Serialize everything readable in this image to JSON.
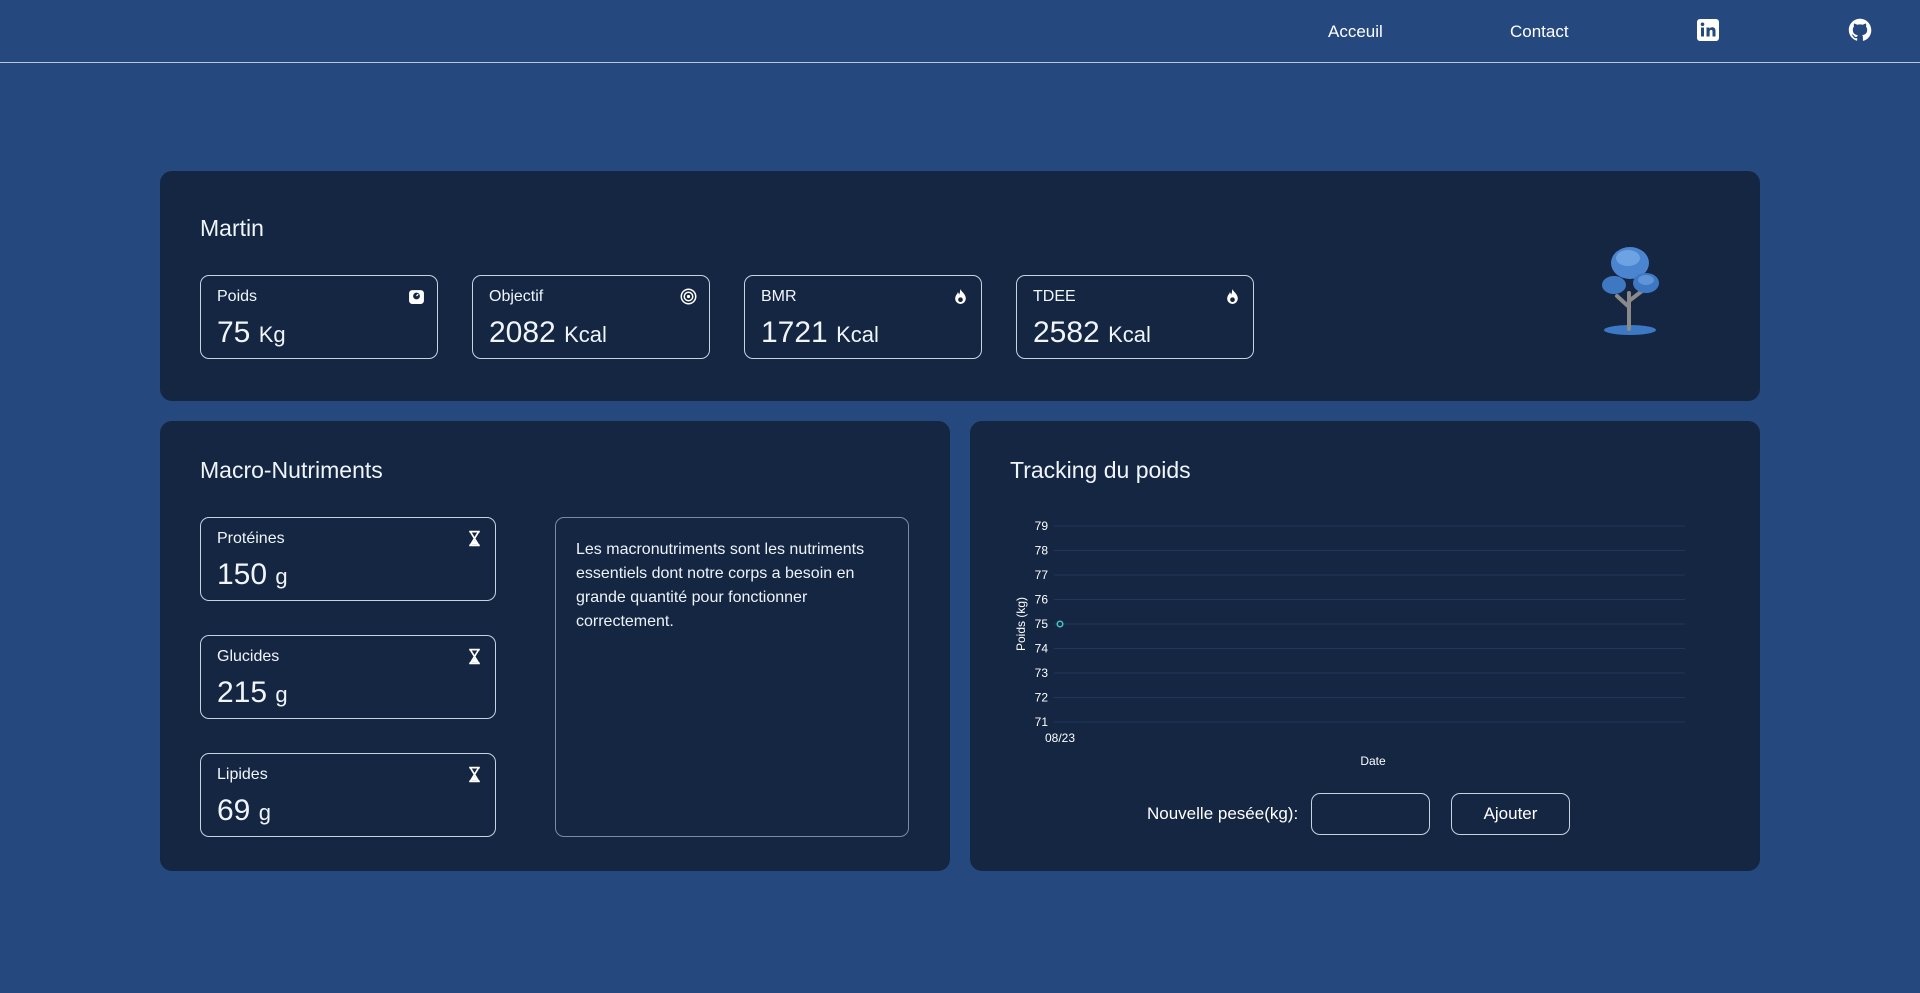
{
  "nav": {
    "links": [
      "Acceuil",
      "Contact"
    ],
    "icons": [
      "linkedin-icon",
      "github-icon"
    ]
  },
  "profile": {
    "name": "Martin",
    "stats": [
      {
        "label": "Poids",
        "value": "75",
        "unit": "Kg",
        "icon": "scale-icon"
      },
      {
        "label": "Objectif",
        "value": "2082",
        "unit": "Kcal",
        "icon": "target-icon"
      },
      {
        "label": "BMR",
        "value": "1721",
        "unit": "Kcal",
        "icon": "flame-icon"
      },
      {
        "label": "TDEE",
        "value": "2582",
        "unit": "Kcal",
        "icon": "flame-icon"
      }
    ],
    "illustration": "tree-illustration"
  },
  "macros": {
    "title": "Macro-Nutriments",
    "items": [
      {
        "label": "Protéines",
        "value": "150",
        "unit": "g",
        "icon": "hourglass-icon"
      },
      {
        "label": "Glucides",
        "value": "215",
        "unit": "g",
        "icon": "hourglass-icon"
      },
      {
        "label": "Lipides",
        "value": "69",
        "unit": "g",
        "icon": "hourglass-icon"
      }
    ],
    "description": "Les macronutriments sont les nutriments essentiels dont notre corps a besoin en grande quantité pour fonctionner correctement."
  },
  "tracking": {
    "title": "Tracking du poids",
    "input_label": "Nouvelle pesée(kg):",
    "input_value": "",
    "button_label": "Ajouter"
  },
  "chart_data": {
    "type": "scatter",
    "title": "",
    "xlabel": "Date",
    "ylabel": "Poids (kg)",
    "x": [
      "08/23"
    ],
    "y": [
      75
    ],
    "ylim": [
      71,
      79
    ],
    "yticks": [
      71,
      72,
      73,
      74,
      75,
      76,
      77,
      78,
      79
    ],
    "grid": true,
    "point_color": "#4bc0c0",
    "series": [
      {
        "values": [
          75
        ]
      }
    ]
  },
  "colors": {
    "page_bg": "#25487e",
    "card_bg": "#142642",
    "border": "#c7d2e3"
  }
}
